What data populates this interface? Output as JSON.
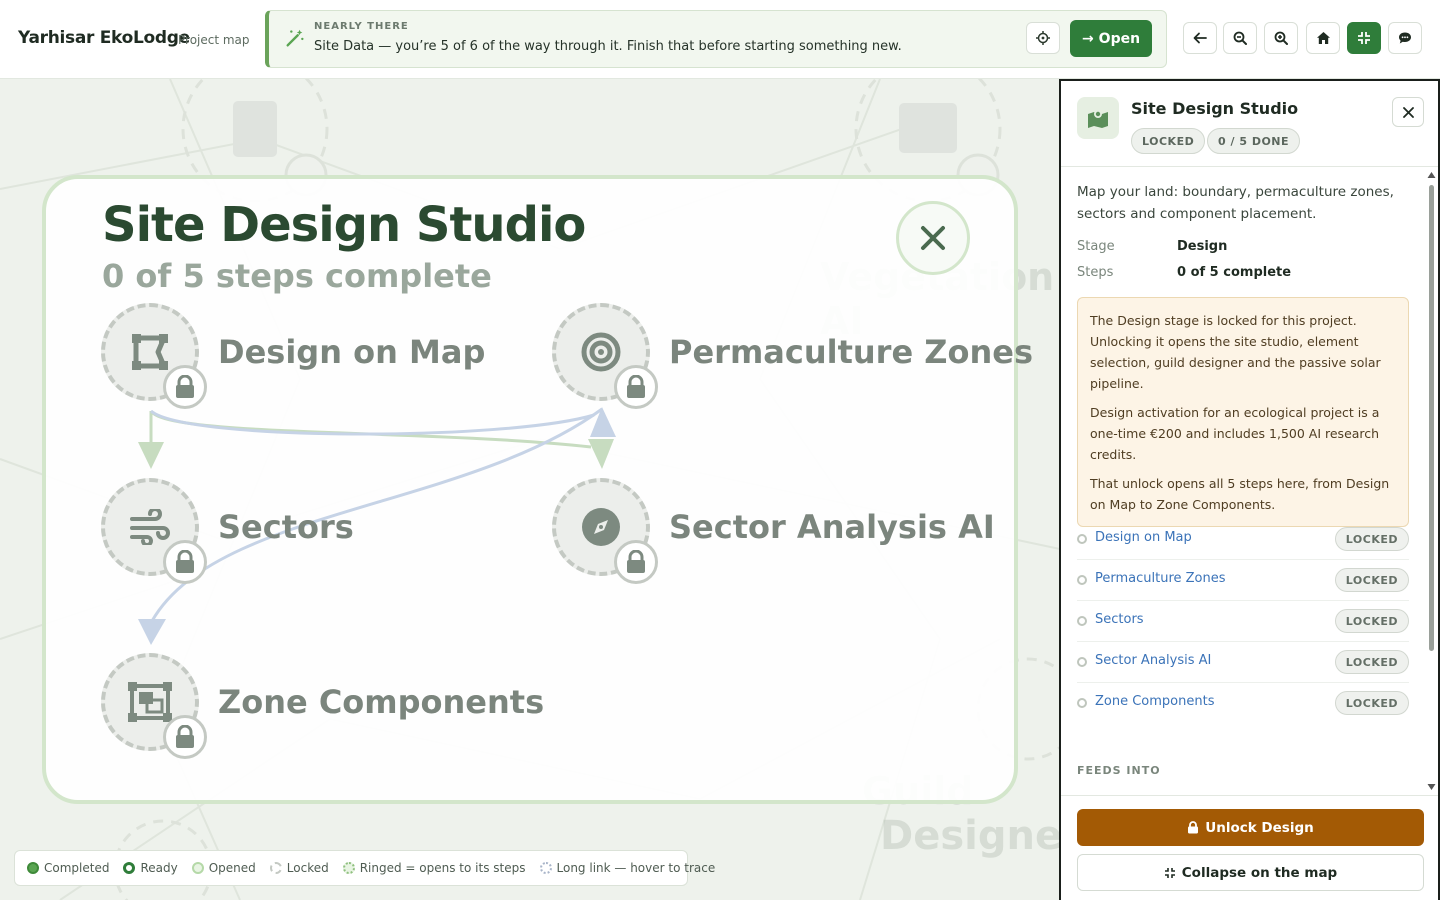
{
  "header": {
    "app_title": "Yarhisar EkoLodge",
    "app_subtitle": "Project map",
    "banner_kicker": "NEARLY THERE",
    "banner_text": "Site Data — you’re 5 of 6 of the way through it. Finish that before starting something new.",
    "open_label": "Open",
    "accent_color": "#2f7d3a"
  },
  "toolbar": {
    "icons": [
      "back-icon",
      "zoom-out-icon",
      "zoom-in-icon",
      "home-icon",
      "collapse-icon",
      "chat-icon"
    ]
  },
  "map": {
    "ghost_labels": [
      "Vegetation AI",
      "Guild",
      "Designer"
    ]
  },
  "studio": {
    "title": "Site Design Studio",
    "subtitle": "0 of 5 steps complete",
    "nodes": [
      {
        "label": "Design on Map",
        "icon": "vector-square-icon"
      },
      {
        "label": "Permaculture Zones",
        "icon": "bullseye-icon"
      },
      {
        "label": "Sectors",
        "icon": "wind-icon"
      },
      {
        "label": "Sector Analysis AI",
        "icon": "compass-icon"
      },
      {
        "label": "Zone Components",
        "icon": "object-group-icon"
      }
    ]
  },
  "legend": [
    {
      "label": "Completed",
      "color": "#5aa552"
    },
    {
      "label": "Ready",
      "color": "#2f7d3a"
    },
    {
      "label": "Opened",
      "color": "#b5d9a8"
    },
    {
      "label": "Locked",
      "color": "#c4c9c3"
    },
    {
      "label": "Ringed = opens to its steps",
      "color": "#8fc07f"
    },
    {
      "label": "Long link — hover to trace",
      "color": "#a9b5c9"
    }
  ],
  "panel": {
    "title": "Site Design Studio",
    "status_badge": "LOCKED",
    "progress_badge": "0 / 5 DONE",
    "description": "Map your land: boundary, permaculture zones, sectors and component placement.",
    "stage_label": "Stage",
    "stage_value": "Design",
    "steps_label": "Steps",
    "steps_value": "0 of 5 complete",
    "notice": [
      "The Design stage is locked for this project. Unlocking it opens the site studio, element selection, guild designer and the passive solar pipeline.",
      "Design activation for an ecological project is a one-time €200 and includes 1,500 AI research credits.",
      "That unlock opens all 5 steps here, from Design on Map to Zone Components."
    ],
    "steps": [
      {
        "name": "Design on Map",
        "status": "LOCKED"
      },
      {
        "name": "Permaculture Zones",
        "status": "LOCKED"
      },
      {
        "name": "Sectors",
        "status": "LOCKED"
      },
      {
        "name": "Sector Analysis AI",
        "status": "LOCKED"
      },
      {
        "name": "Zone Components",
        "status": "LOCKED"
      }
    ],
    "feeds_into_label": "FEEDS INTO",
    "unlock_label": "Unlock Design",
    "collapse_label": "Collapse on the map",
    "unlock_color": "#a35a05"
  }
}
